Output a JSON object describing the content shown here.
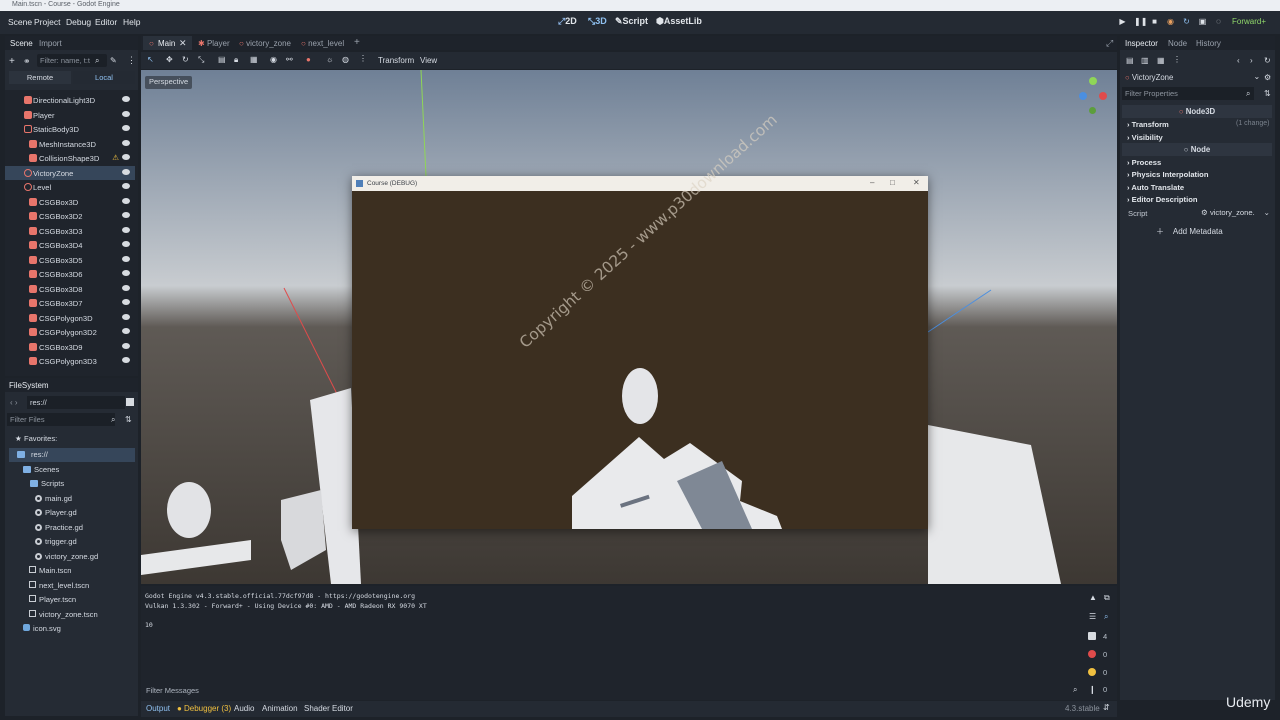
{
  "window_title": "Main.tscn - Course - Godot Engine",
  "menu": [
    "Scene",
    "Project",
    "Debug",
    "Editor",
    "Help"
  ],
  "modes": [
    "2D",
    "3D",
    "Script",
    "AssetLib"
  ],
  "renderer": "Forward+",
  "scene_dock": {
    "tabs": [
      "Scene",
      "Import"
    ],
    "filter_placeholder": "Filter: name, t:t",
    "remote": "Remote",
    "local": "Local",
    "nodes": [
      "DirectionalLight3D",
      "Player",
      "StaticBody3D",
      "MeshInstance3D",
      "CollisionShape3D",
      "VictoryZone",
      "Level",
      "CSGBox3D",
      "CSGBox3D2",
      "CSGBox3D3",
      "CSGBox3D4",
      "CSGBox3D5",
      "CSGBox3D6",
      "CSGBox3D8",
      "CSGBox3D7",
      "CSGPolygon3D",
      "CSGPolygon3D2",
      "CSGBox3D9",
      "CSGPolygon3D3"
    ]
  },
  "filesystem": {
    "title": "FileSystem",
    "path": "res://",
    "filter_placeholder": "Filter Files",
    "items": [
      "Favorites:",
      "res://",
      "Scenes",
      "Scripts",
      "main.gd",
      "Player.gd",
      "Practice.gd",
      "trigger.gd",
      "victory_zone.gd",
      "Main.tscn",
      "next_level.tscn",
      "Player.tscn",
      "victory_zone.tscn",
      "icon.svg"
    ]
  },
  "scene_tabs": [
    "Main",
    "Player",
    "victory_zone",
    "next_level"
  ],
  "toolbar": {
    "transform": "Transform",
    "view": "View"
  },
  "viewport": {
    "perspective": "Perspective"
  },
  "game_window": {
    "title": "Course (DEBUG)",
    "watermark": "Copyright © 2025 - www.p30download.com"
  },
  "output": {
    "lines": [
      "Godot Engine v4.3.stable.official.77dcf97d8 - https://godotengine.org",
      "Vulkan 1.3.302 - Forward+ - Using Device #0: AMD - AMD Radeon RX 9070 XT",
      "",
      "10"
    ],
    "filter_placeholder": "Filter Messages",
    "counts": [
      "4",
      "0",
      "0",
      "0"
    ]
  },
  "bottom_tabs": [
    "Output",
    "Debugger (3)",
    "Audio",
    "Animation",
    "Shader Editor"
  ],
  "version": "4.3.stable",
  "inspector": {
    "tabs": [
      "Inspector",
      "Node",
      "History"
    ],
    "node": "VictoryZone",
    "filter_placeholder": "Filter Properties",
    "section_node3d": "Node3D",
    "transform": "Transform",
    "transform_changes": "(1 change)",
    "visibility": "Visibility",
    "section_node": "Node",
    "process": "Process",
    "physics_interpolation": "Physics Interpolation",
    "auto_translate": "Auto Translate",
    "editor_description": "Editor Description",
    "script_label": "Script",
    "script_value": "victory_zone.",
    "add_metadata": "Add Metadata"
  },
  "brand": "Udemy"
}
